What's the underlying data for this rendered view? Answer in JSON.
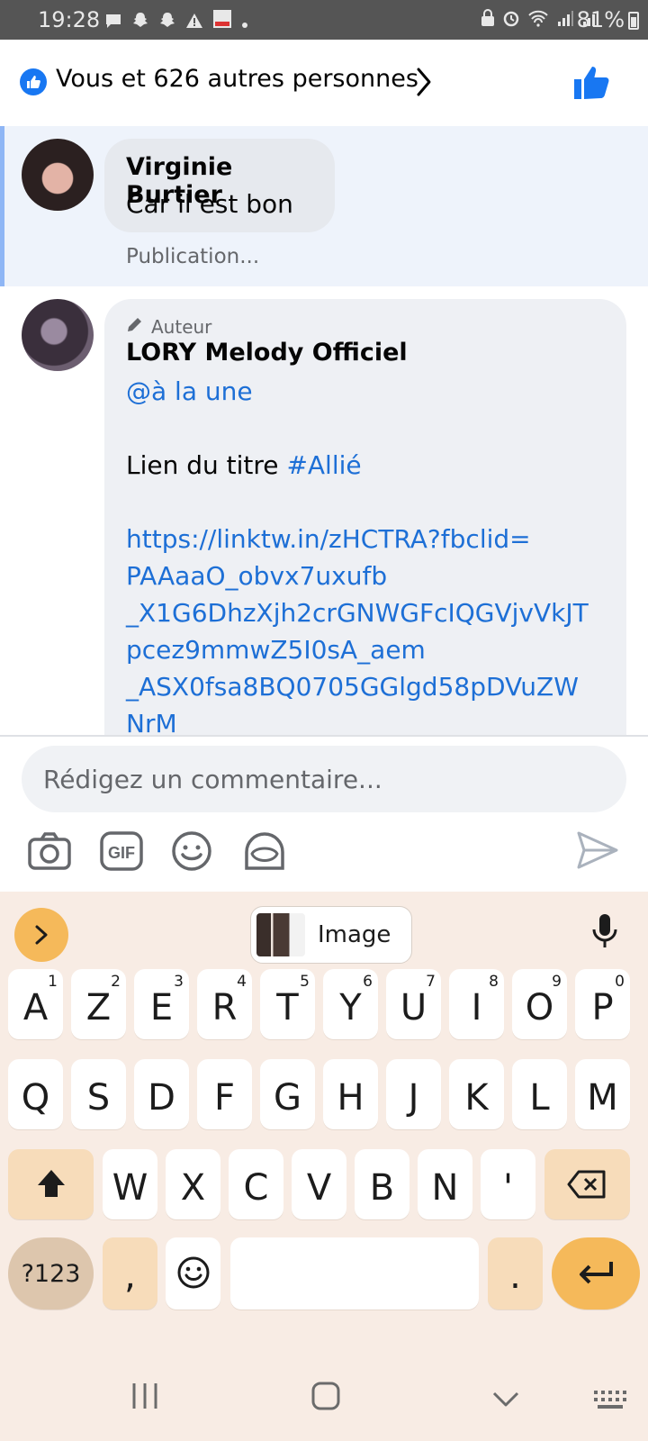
{
  "status_bar": {
    "time": "19:28",
    "battery": "81%"
  },
  "header": {
    "reactions_text": "Vous et 626 autres personnes"
  },
  "comments": [
    {
      "author": "Virginie Burtier",
      "text": "Car il est bon",
      "meta": "Publication..."
    },
    {
      "badge": "Auteur",
      "author": "LORY Melody Officiel",
      "mention": "@à la une",
      "text_prefix": "Lien du titre",
      "hashtag": "#Allié",
      "link_lines": [
        "https://linktw.in/zHCTRA?fbclid=",
        "PAAaaO_obvx7uxufb",
        "_X1G6DhzXjh2crGNWGFcIQGVjvVkJT",
        "pcez9mmwZ5I0sA_aem",
        "_ASX0fsa8BQ0705GGlgd58pDVuZW",
        "NrM"
      ]
    }
  ],
  "composer": {
    "placeholder": "Rédigez un commentaire..."
  },
  "keyboard": {
    "suggestion_label": "Image",
    "row1": [
      {
        "k": "A",
        "n": "1"
      },
      {
        "k": "Z",
        "n": "2"
      },
      {
        "k": "E",
        "n": "3"
      },
      {
        "k": "R",
        "n": "4"
      },
      {
        "k": "T",
        "n": "5"
      },
      {
        "k": "Y",
        "n": "6"
      },
      {
        "k": "U",
        "n": "7"
      },
      {
        "k": "I",
        "n": "8"
      },
      {
        "k": "O",
        "n": "9"
      },
      {
        "k": "P",
        "n": "0"
      }
    ],
    "row2": [
      "Q",
      "S",
      "D",
      "F",
      "G",
      "H",
      "J",
      "K",
      "L",
      "M"
    ],
    "row3": [
      "W",
      "X",
      "C",
      "V",
      "B",
      "N",
      "'"
    ],
    "symbols_label": "?123",
    "comma": ",",
    "period": "."
  },
  "colors": {
    "facebook_blue": "#1877f2",
    "link_blue": "#1d6fd6",
    "keyboard_bg": "#f8ece4",
    "accent_key": "#f5b95a"
  }
}
